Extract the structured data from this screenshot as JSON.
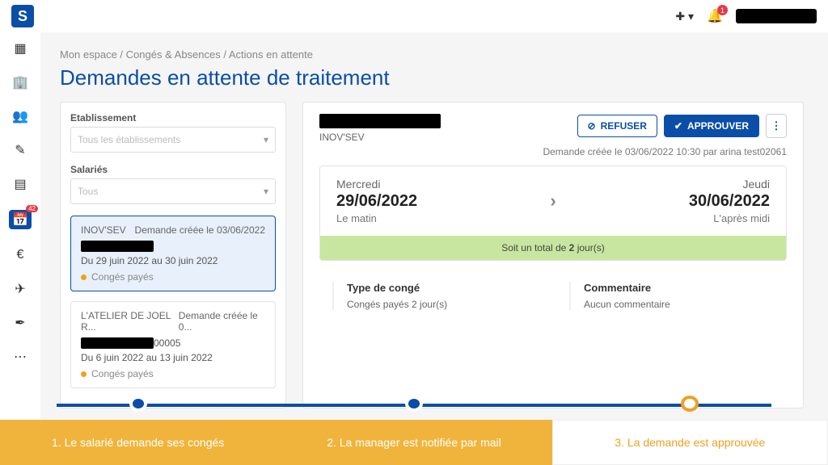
{
  "topbar": {
    "bell_badge": "1"
  },
  "sidenav": {
    "calendar_badge": "42"
  },
  "breadcrumb": "Mon espace / Congés & Absences / Actions en attente",
  "page_title": "Demandes en attente de traitement",
  "filters": {
    "establishment_label": "Etablissement",
    "establishment_value": "Tous les établissements",
    "employees_label": "Salariés",
    "employees_value": "Tous"
  },
  "requests": [
    {
      "estab": "INOV'SEV",
      "created": "Demande créée le 03/06/2022",
      "range": "Du 29 juin 2022 au 30 juin 2022",
      "type": "Congés payés",
      "selected": true
    },
    {
      "estab": "L'ATELIER DE JOEL R...",
      "created": "Demande créée le 0...",
      "id_suffix": "00005",
      "range": "Du 6 juin 2022 au 13 juin 2022",
      "type": "Congés payés",
      "selected": false
    }
  ],
  "detail": {
    "estab": "INOV'SEV",
    "refuse": "REFUSER",
    "approve": "APPROUVER",
    "created_info": "Demande créée le 03/06/2022 10:30 par arina test02061",
    "start_day": "Mercredi",
    "start_date": "29/06/2022",
    "start_part": "Le matin",
    "end_day": "Jeudi",
    "end_date": "30/06/2022",
    "end_part": "L'après midi",
    "total_pre": "Soit un total de ",
    "total_num": "2",
    "total_post": " jour(s)",
    "type_label": "Type de congé",
    "type_value": "Congés payés   2 jour(s)",
    "comment_label": "Commentaire",
    "comment_value": "Aucun commentaire"
  },
  "stepper": {
    "s1": "1. Le salarié demande ses congés",
    "s2": "2. La manager est notifiée par mail",
    "s3": "3. La demande est approuvée"
  }
}
